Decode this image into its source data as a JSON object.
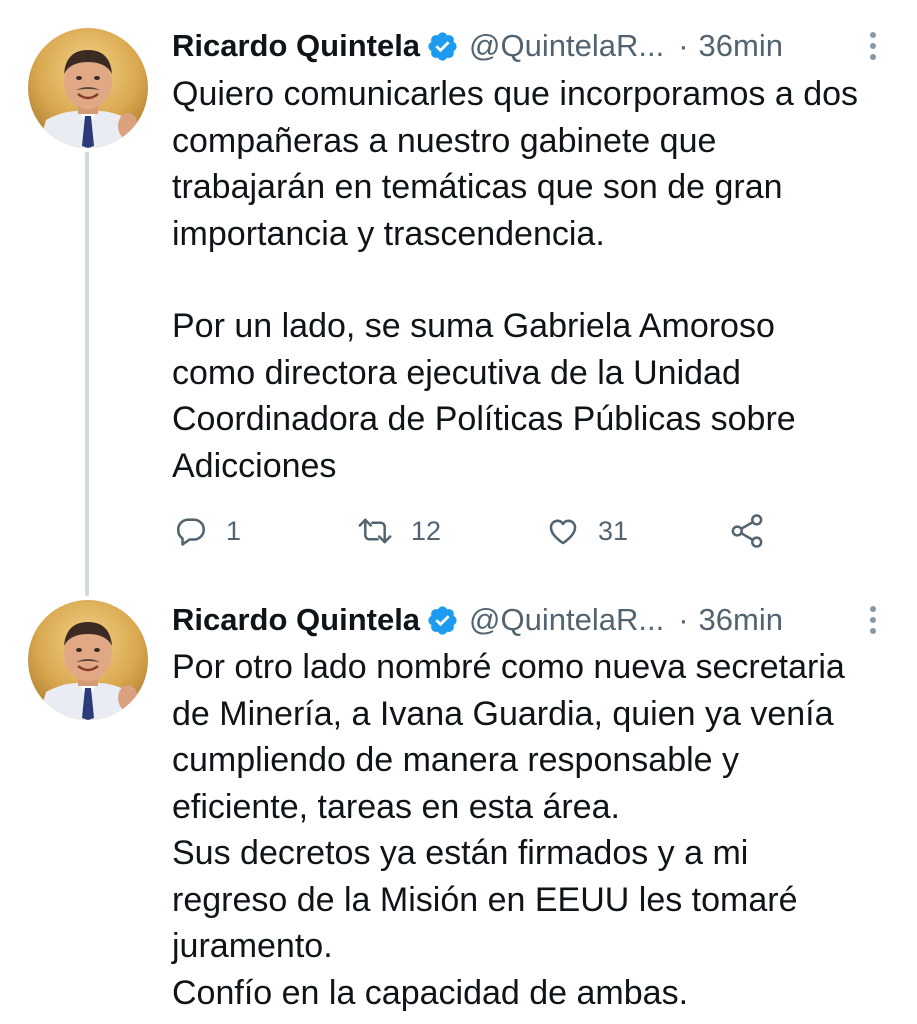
{
  "tweets": [
    {
      "author": {
        "display_name": "Ricardo Quintela",
        "handle": "@QuintelaR...",
        "verified": true
      },
      "separator": "·",
      "time": "36min",
      "paragraphs": [
        [
          "Quiero comunicarles que incorporamos a dos",
          "compañeras a nuestro gabinete que",
          "trabajarán en temáticas que son de gran",
          "importancia y trascendencia."
        ],
        [
          "Por un lado, se suma Gabriela Amoroso",
          "como directora ejecutiva de la Unidad",
          "Coordinadora de Políticas Públicas sobre",
          "Adicciones"
        ]
      ],
      "stats": {
        "replies": "1",
        "retweets": "12",
        "likes": "31"
      }
    },
    {
      "author": {
        "display_name": "Ricardo Quintela",
        "handle": "@QuintelaR...",
        "verified": true
      },
      "separator": "·",
      "time": "36min",
      "lines": [
        "Por otro lado nombré como nueva secretaria",
        "de Minería, a Ivana Guardia,  quien ya venía",
        "cumpliendo de manera responsable y",
        "eficiente, tareas en esta área.",
        "Sus decretos ya están firmados y a mi",
        "regreso de la Misión en EEUU les tomaré",
        "juramento.",
        "Confío en la capacidad de ambas."
      ]
    }
  ],
  "icons": {
    "verified": "verified-badge-icon",
    "more": "more-vertical-icon",
    "reply": "reply-icon",
    "retweet": "retweet-icon",
    "like": "heart-icon",
    "share": "share-icon"
  },
  "colors": {
    "text": "#0f1419",
    "secondary": "#536471",
    "verified": "#1d9bf0",
    "thread_line": "#cfd9de"
  }
}
